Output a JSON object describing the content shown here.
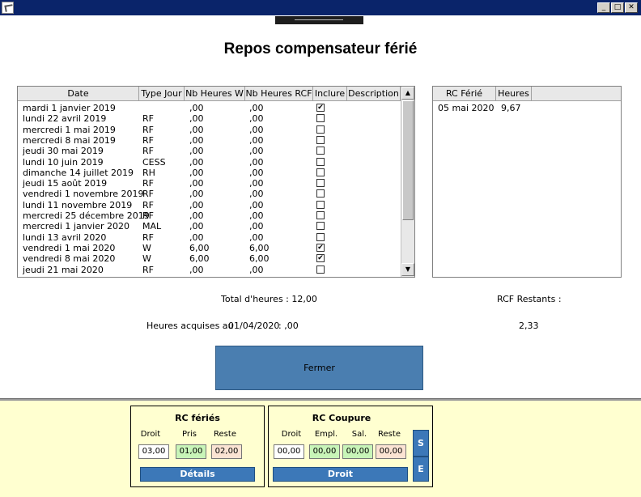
{
  "window": {
    "minimize_label": "_",
    "maximize_label": "□",
    "close_label": "✕"
  },
  "title": "Repos compensateur férié",
  "main_table": {
    "columns": [
      "Date",
      "Type Jour",
      "Nb Heures W",
      "Nb Heures RCF",
      "Inclure",
      "Description"
    ],
    "rows": [
      {
        "date": "mardi 1 janvier 2019",
        "type": "",
        "w": ",00",
        "rcf": ",00",
        "inclure": true
      },
      {
        "date": "lundi 22 avril 2019",
        "type": "RF",
        "w": ",00",
        "rcf": ",00",
        "inclure": false
      },
      {
        "date": "mercredi 1 mai 2019",
        "type": "RF",
        "w": ",00",
        "rcf": ",00",
        "inclure": false
      },
      {
        "date": "mercredi 8 mai 2019",
        "type": "RF",
        "w": ",00",
        "rcf": ",00",
        "inclure": false
      },
      {
        "date": "jeudi 30 mai 2019",
        "type": "RF",
        "w": ",00",
        "rcf": ",00",
        "inclure": false
      },
      {
        "date": "lundi 10 juin 2019",
        "type": "CESS",
        "w": ",00",
        "rcf": ",00",
        "inclure": false
      },
      {
        "date": "dimanche 14 juillet 2019",
        "type": "RH",
        "w": ",00",
        "rcf": ",00",
        "inclure": false
      },
      {
        "date": "jeudi 15 août 2019",
        "type": "RF",
        "w": ",00",
        "rcf": ",00",
        "inclure": false
      },
      {
        "date": "vendredi 1 novembre 2019",
        "type": "RF",
        "w": ",00",
        "rcf": ",00",
        "inclure": false
      },
      {
        "date": "lundi 11 novembre 2019",
        "type": "RF",
        "w": ",00",
        "rcf": ",00",
        "inclure": false
      },
      {
        "date": "mercredi 25 décembre 2019",
        "type": "RF",
        "w": ",00",
        "rcf": ",00",
        "inclure": false
      },
      {
        "date": "mercredi 1 janvier 2020",
        "type": "MAL",
        "w": ",00",
        "rcf": ",00",
        "inclure": false
      },
      {
        "date": "lundi 13 avril 2020",
        "type": "RF",
        "w": ",00",
        "rcf": ",00",
        "inclure": false
      },
      {
        "date": "vendredi 1 mai 2020",
        "type": "W",
        "w": "6,00",
        "rcf": "6,00",
        "inclure": true
      },
      {
        "date": "vendredi 8 mai 2020",
        "type": "W",
        "w": "6,00",
        "rcf": "6,00",
        "inclure": true
      },
      {
        "date": "jeudi 21 mai 2020",
        "type": "RF",
        "w": ",00",
        "rcf": ",00",
        "inclure": false
      }
    ]
  },
  "side_table": {
    "columns": [
      "RC Férié",
      "Heures"
    ],
    "rows": [
      {
        "date": "05 mai 2020",
        "heures": "9,67"
      }
    ]
  },
  "summary": {
    "total_label": "Total d'heures : 12,00",
    "rcf_restants_label": "RCF Restants :",
    "acquises_label": "Heures acquises au",
    "acquises_date": "01/04/2020",
    "acquises_value": ": ,00",
    "rcf_restants_value": "2,33"
  },
  "close_button_label": "Fermer",
  "rc_feries": {
    "title": "RC fériés",
    "labels": [
      "Droit",
      "Pris",
      "Reste"
    ],
    "values": [
      "03,00",
      "01,00",
      "02,00"
    ],
    "details_label": "Détails"
  },
  "rc_coupure": {
    "title": "RC Coupure",
    "labels": [
      "Droit",
      "Empl.",
      "Sal.",
      "Reste"
    ],
    "values": [
      "00,00",
      "00,00",
      "00,00",
      "00,00"
    ],
    "droit_button_label": "Droit",
    "s_label": "S",
    "e_label": "E"
  },
  "colors": {
    "titlebar": "#0a246a",
    "button_blue": "#4a7eb0",
    "field_green": "#c8f5b8",
    "field_peach": "#fbe3d3",
    "panel_bg": "#ffffd0"
  }
}
